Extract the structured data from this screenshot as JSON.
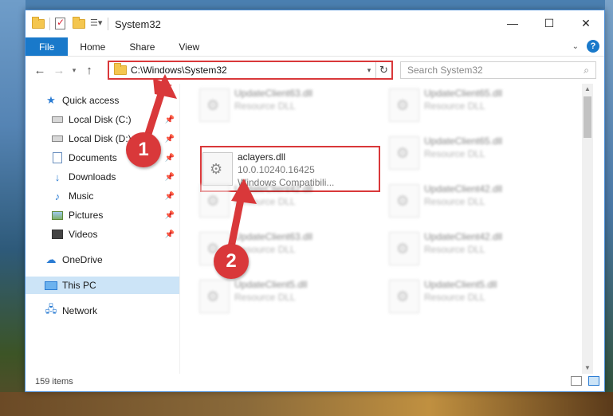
{
  "window": {
    "title": "System32",
    "controls": {
      "minimize": "—",
      "maximize": "☐",
      "close": "✕"
    }
  },
  "ribbon": {
    "tabs": [
      "File",
      "Home",
      "Share",
      "View"
    ]
  },
  "address": {
    "path": "C:\\Windows\\System32",
    "search_placeholder": "Search System32"
  },
  "sidebar": {
    "items": [
      {
        "label": "Quick access",
        "icon": "star-icon",
        "pinned": false
      },
      {
        "label": "Local Disk (C:)",
        "icon": "disk-icon",
        "pinned": true
      },
      {
        "label": "Local Disk (D:)",
        "icon": "disk-icon",
        "pinned": true
      },
      {
        "label": "Documents",
        "icon": "documents-icon",
        "pinned": true
      },
      {
        "label": "Downloads",
        "icon": "download-icon",
        "pinned": true
      },
      {
        "label": "Music",
        "icon": "music-icon",
        "pinned": true
      },
      {
        "label": "Pictures",
        "icon": "pictures-icon",
        "pinned": true
      },
      {
        "label": "Videos",
        "icon": "videos-icon",
        "pinned": true
      },
      {
        "label": "OneDrive",
        "icon": "onedrive-icon",
        "pinned": false
      },
      {
        "label": "This PC",
        "icon": "this-pc-icon",
        "pinned": false,
        "active": true
      },
      {
        "label": "Network",
        "icon": "network-icon",
        "pinned": false
      }
    ]
  },
  "files": {
    "highlighted": {
      "name": "aclayers.dll",
      "version": "10.0.10240.16425",
      "description": "Windows Compatibili..."
    },
    "blurred": [
      {
        "name": "UpdateClient63.dll",
        "type": "Resource DLL"
      },
      {
        "name": "UpdateClient65.dll",
        "type": "Resource DLL"
      },
      {
        "name": "UpdateClient65.dll",
        "type": "Resource DLL"
      },
      {
        "name": "UpdateClient42.dll",
        "type": "Resource DLL"
      },
      {
        "name": "UpdateClient42.dll",
        "type": "Resource DLL"
      },
      {
        "name": "UpdateClient63.dll",
        "type": "Resource DLL"
      },
      {
        "name": "UpdateClient42.dll",
        "type": "Resource DLL"
      },
      {
        "name": "UpdateClient5.dll",
        "type": "Resource DLL"
      },
      {
        "name": "UpdateClient5.dll",
        "type": "Resource DLL"
      }
    ]
  },
  "status": {
    "item_count": "159 items"
  },
  "callouts": {
    "one": "1",
    "two": "2"
  },
  "colors": {
    "accent": "#1979ca",
    "highlight": "#d9383a",
    "selected_bg": "#cce4f7"
  }
}
